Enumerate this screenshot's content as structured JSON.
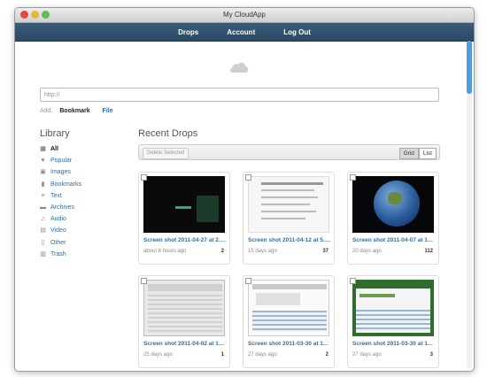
{
  "window": {
    "title": "My CloudApp"
  },
  "nav": {
    "items": [
      {
        "label": "Drops"
      },
      {
        "label": "Account"
      },
      {
        "label": "Log Out"
      }
    ]
  },
  "url_input": {
    "placeholder": "http://"
  },
  "add": {
    "label": "Add:",
    "bookmark": "Bookmark",
    "file": "File"
  },
  "library": {
    "title": "Library",
    "items": [
      {
        "label": "All",
        "icon": "grid-icon"
      },
      {
        "label": "Popular",
        "icon": "heart-icon"
      },
      {
        "label": "Images",
        "icon": "image-icon"
      },
      {
        "label": "Bookmarks",
        "icon": "bookmark-icon"
      },
      {
        "label": "Text",
        "icon": "text-icon"
      },
      {
        "label": "Archives",
        "icon": "folder-icon"
      },
      {
        "label": "Audio",
        "icon": "music-icon"
      },
      {
        "label": "Video",
        "icon": "film-icon"
      },
      {
        "label": "Other",
        "icon": "document-icon"
      },
      {
        "label": "Trash",
        "icon": "trash-icon"
      }
    ]
  },
  "recent": {
    "title": "Recent Drops",
    "delete_label": "Delete Selected",
    "view_grid": "Grid",
    "view_list": "List"
  },
  "drops": [
    {
      "name": "Screen shot 2011-04-27 at 2.33...",
      "age": "about 6 hours ago",
      "count": "2"
    },
    {
      "name": "Screen shot 2011-04-12 at 5.06...",
      "age": "15 days ago",
      "count": "37"
    },
    {
      "name": "Screen shot 2011-04-07 at 11.1...",
      "age": "20 days ago",
      "count": "112"
    },
    {
      "name": "Screen shot 2011-04-02 at 10.1...",
      "age": "25 days ago",
      "count": "1"
    },
    {
      "name": "Screen shot 2011-03-30 at 11.2...",
      "age": "27 days ago",
      "count": "2"
    },
    {
      "name": "Screen shot 2011-03-30 at 11.2...",
      "age": "27 days ago",
      "count": "3"
    }
  ]
}
